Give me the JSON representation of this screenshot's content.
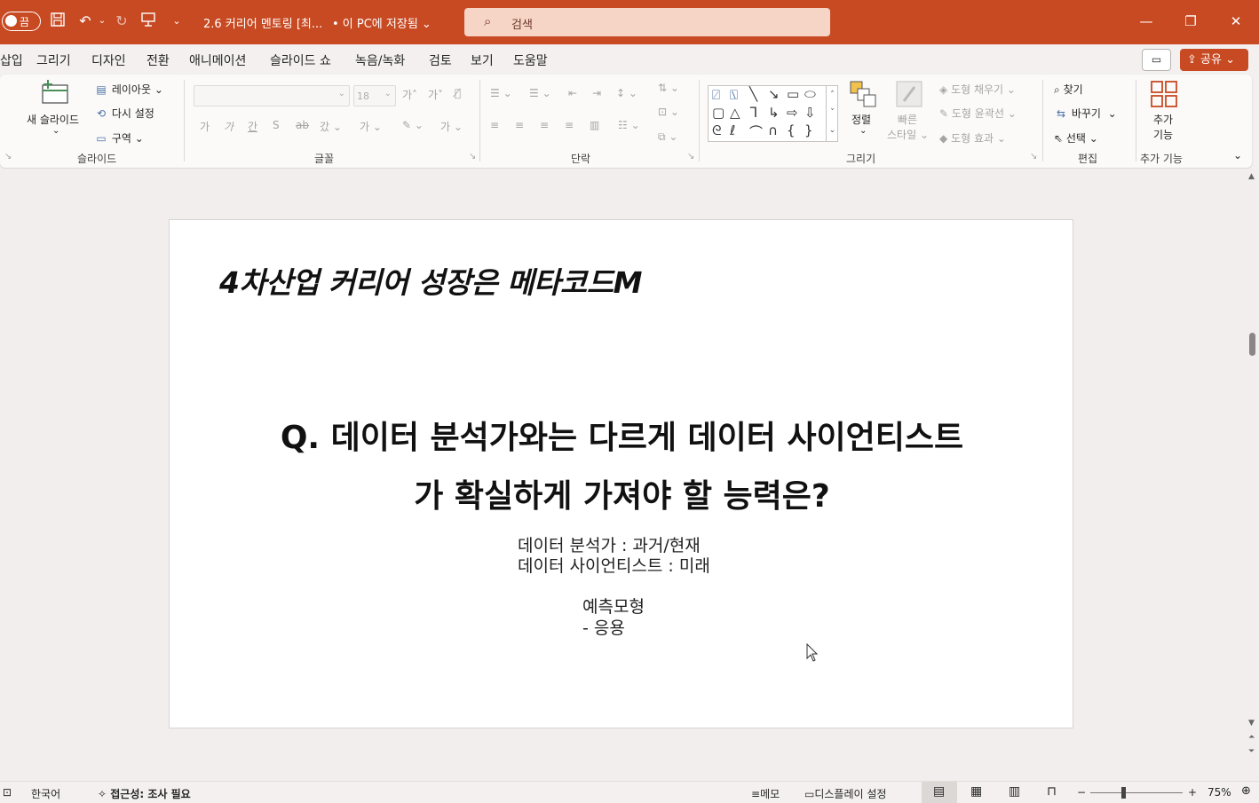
{
  "titlebar": {
    "autosave_label": "끔",
    "doc_title": "2.6 커리어 멘토링 [최...",
    "save_status": "• 이 PC에 저장됨",
    "search_placeholder": "검색",
    "bg_color": "#c84a23"
  },
  "menu": {
    "tabs": [
      "삽입",
      "그리기",
      "디자인",
      "전환",
      "애니메이션",
      "슬라이드 쇼",
      "녹음/녹화",
      "검토",
      "보기",
      "도움말"
    ],
    "share_label": "공유"
  },
  "ribbon": {
    "slides": {
      "new_slide": "새 슬라이드",
      "layout": "레이아웃",
      "reset": "다시 설정",
      "section": "구역",
      "group": "슬라이드"
    },
    "font": {
      "size": "18",
      "group": "글꼴"
    },
    "paragraph": {
      "group": "단락"
    },
    "drawing": {
      "arrange": "정렬",
      "quick_styles_1": "빠른",
      "quick_styles_2": "스타일",
      "shape_fill": "도형 채우기",
      "shape_outline": "도형 윤곽선",
      "shape_effects": "도형 효과",
      "group": "그리기"
    },
    "editing": {
      "find": "찾기",
      "replace": "바꾸기",
      "select": "선택",
      "group": "편집"
    },
    "addins": {
      "label_1": "추가",
      "label_2": "기능",
      "group": "추가 기능"
    }
  },
  "slide": {
    "title": "4차산업 커리어 성장은 메타코드M",
    "question_line1": "Q. 데이터 분석가와는 다르게 데이터 사이언티스트",
    "question_line2": "가 확실하게 가져야 할 능력은?",
    "body": [
      "데이터 분석가 : 과거/현재",
      "데이터 사이언티스트 : 미래",
      "예측모형",
      "- 응용"
    ]
  },
  "status": {
    "language": "한국어",
    "accessibility": "접근성: 조사 필요",
    "notes": "메모",
    "display_settings": "디스플레이 설정",
    "zoom": "75%"
  }
}
